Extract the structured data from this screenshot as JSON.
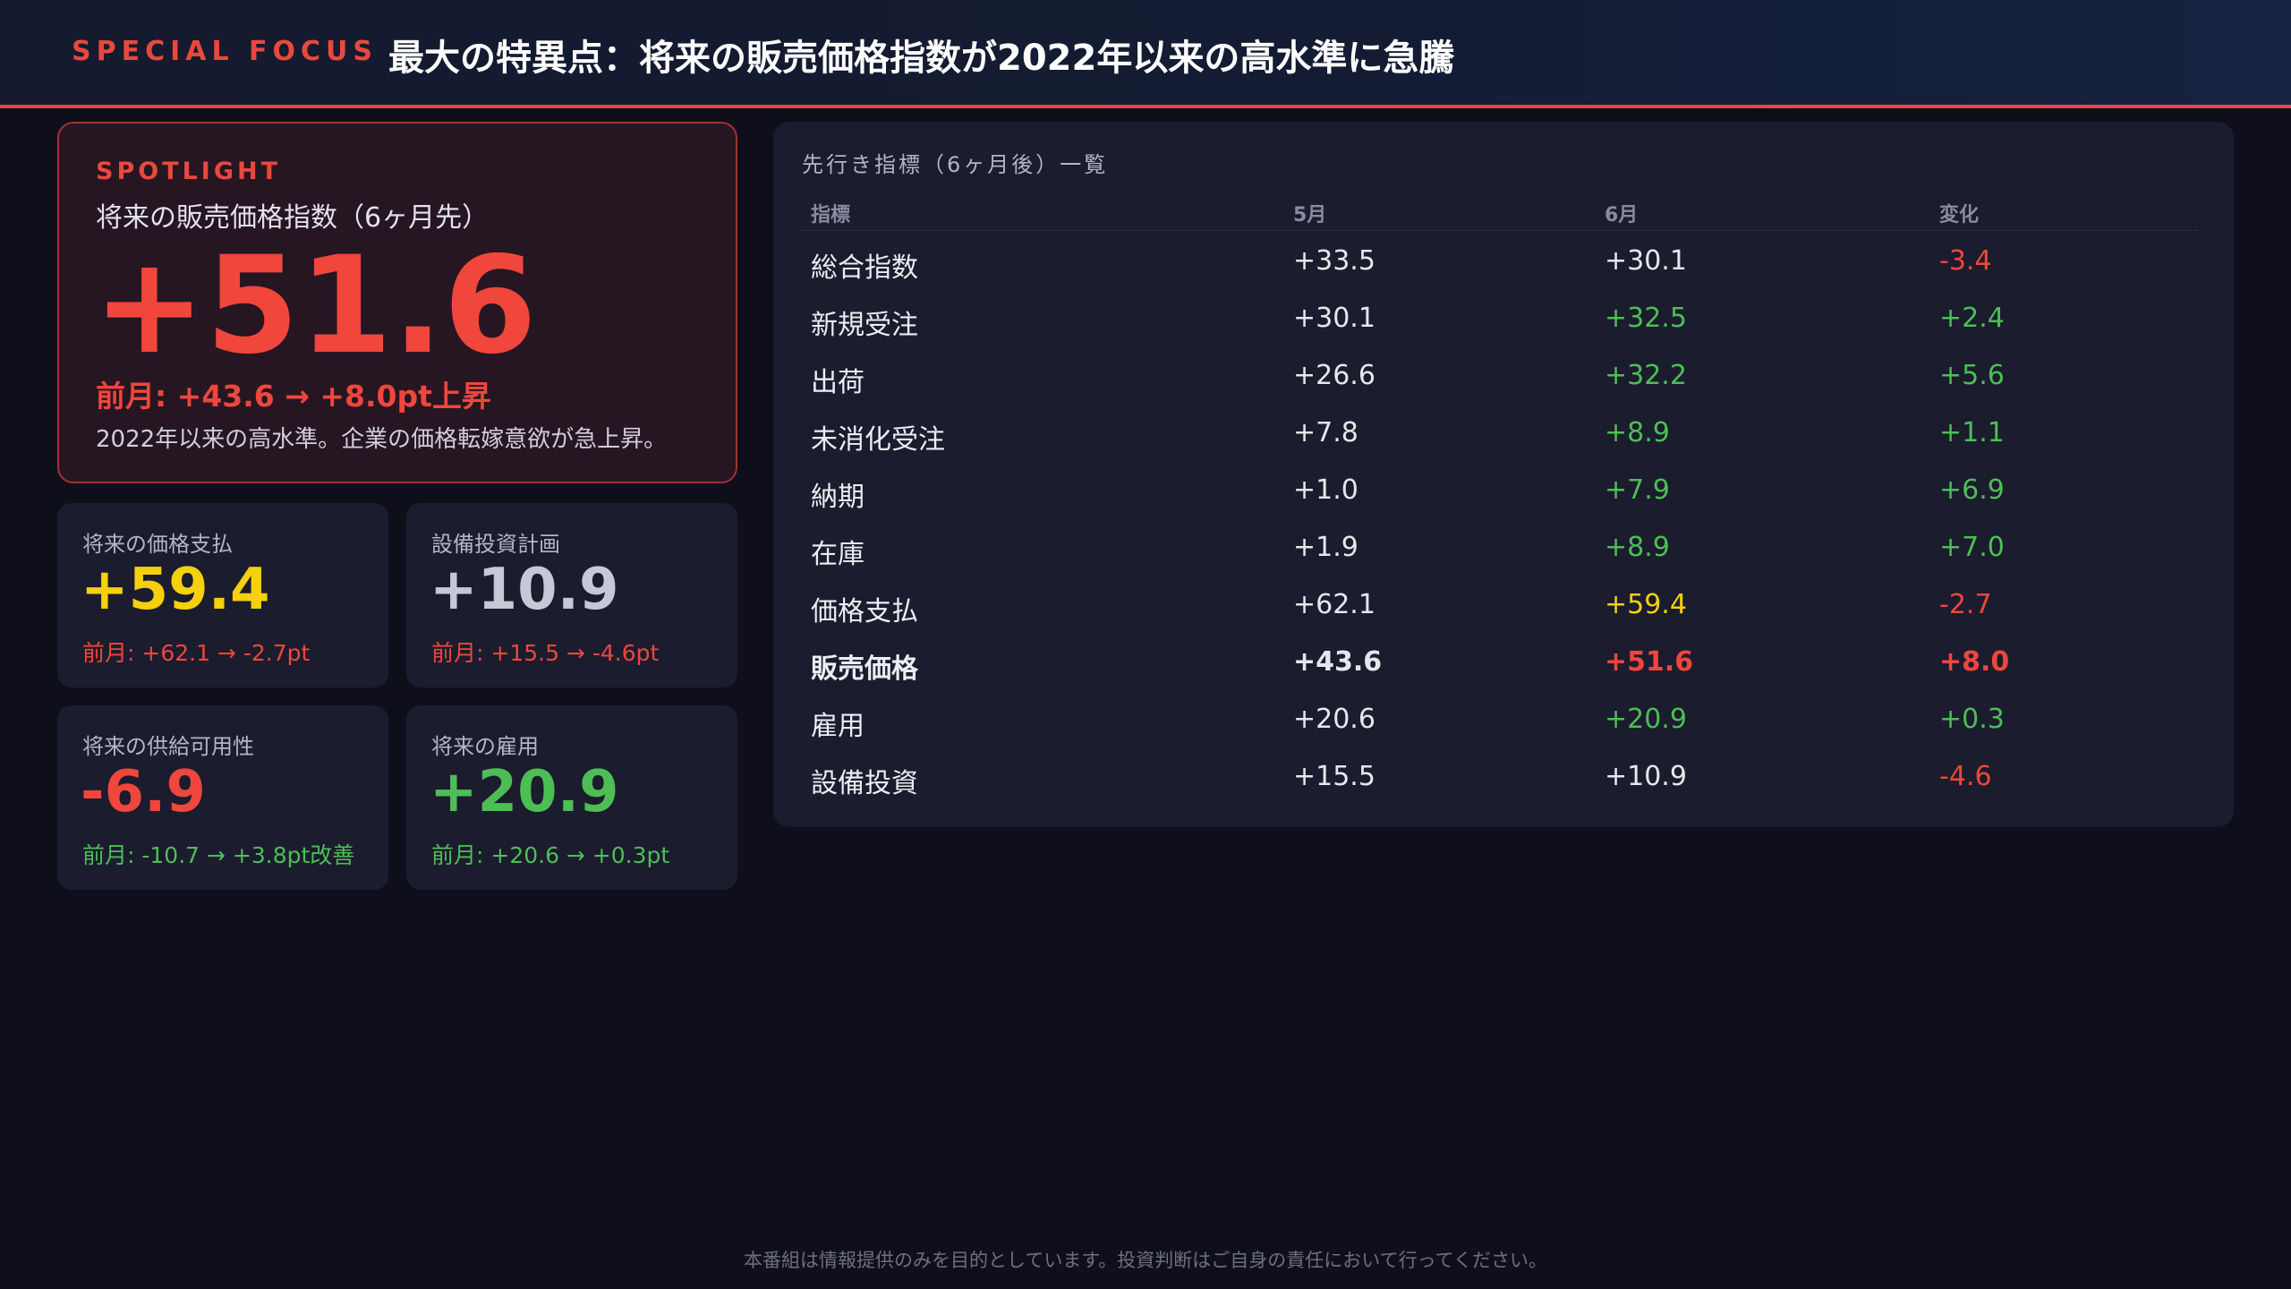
{
  "header": {
    "tag": "SPECIAL FOCUS",
    "title": "最大の特異点：将来の販売価格指数が2022年以来の高水準に急騰"
  },
  "spotlight": {
    "label": "SPOTLIGHT",
    "subtitle": "将来の販売価格指数（6ヶ月先）",
    "value": "+51.6",
    "change": "前月: +43.6 → +8.0pt上昇",
    "note": "2022年以来の高水準。企業の価格転嫁意欲が急上昇。"
  },
  "cards": [
    {
      "label": "将来の価格支払",
      "value": "+59.4",
      "change": "前月: +62.1 → -2.7pt",
      "value_color": "#f5d00c",
      "change_color": "#f0463c"
    },
    {
      "label": "設備投資計画",
      "value": "+10.9",
      "change": "前月: +15.5 → -4.6pt",
      "value_color": "#c7c7d6",
      "change_color": "#f0463c"
    },
    {
      "label": "将来の供給可用性",
      "value": "-6.9",
      "change": "前月: -10.7 → +3.8pt改善",
      "value_color": "#f0463c",
      "change_color": "#4cbe55"
    },
    {
      "label": "将来の雇用",
      "value": "+20.9",
      "change": "前月: +20.6 → +0.3pt",
      "value_color": "#4cbe55",
      "change_color": "#4cbe55"
    }
  ],
  "table": {
    "title": "先行き指標（6ヶ月後）一覧",
    "headers": [
      "指標",
      "5月",
      "6月",
      "変化"
    ],
    "rows": [
      {
        "name": "総合指数",
        "may": "+33.5",
        "june": "+30.1",
        "change": "-3.4",
        "june_color": "white",
        "change_color": "red",
        "bold": false
      },
      {
        "name": "新規受注",
        "may": "+30.1",
        "june": "+32.5",
        "change": "+2.4",
        "june_color": "green",
        "change_color": "green",
        "bold": false
      },
      {
        "name": "出荷",
        "may": "+26.6",
        "june": "+32.2",
        "change": "+5.6",
        "june_color": "green",
        "change_color": "green",
        "bold": false
      },
      {
        "name": "未消化受注",
        "may": "+7.8",
        "june": "+8.9",
        "change": "+1.1",
        "june_color": "green",
        "change_color": "green",
        "bold": false
      },
      {
        "name": "納期",
        "may": "+1.0",
        "june": "+7.9",
        "change": "+6.9",
        "june_color": "green",
        "change_color": "green",
        "bold": false
      },
      {
        "name": "在庫",
        "may": "+1.9",
        "june": "+8.9",
        "change": "+7.0",
        "june_color": "green",
        "change_color": "green",
        "bold": false
      },
      {
        "name": "価格支払",
        "may": "+62.1",
        "june": "+59.4",
        "change": "-2.7",
        "june_color": "yellow",
        "change_color": "red",
        "bold": false
      },
      {
        "name": "販売価格",
        "may": "+43.6",
        "june": "+51.6",
        "change": "+8.0",
        "june_color": "red",
        "change_color": "red",
        "bold": true
      },
      {
        "name": "雇用",
        "may": "+20.6",
        "june": "+20.9",
        "change": "+0.3",
        "june_color": "green",
        "change_color": "green",
        "bold": false
      },
      {
        "name": "設備投資",
        "may": "+15.5",
        "june": "+10.9",
        "change": "-4.6",
        "june_color": "white",
        "change_color": "red",
        "bold": false
      }
    ]
  },
  "footer": "本番組は情報提供のみを目的としています。投資判断はご自身の責任において行ってください。",
  "colors": {
    "accent_red": "#f0463c",
    "green": "#4cbe55",
    "yellow": "#f5d00c",
    "background": "#0f0f1c"
  }
}
